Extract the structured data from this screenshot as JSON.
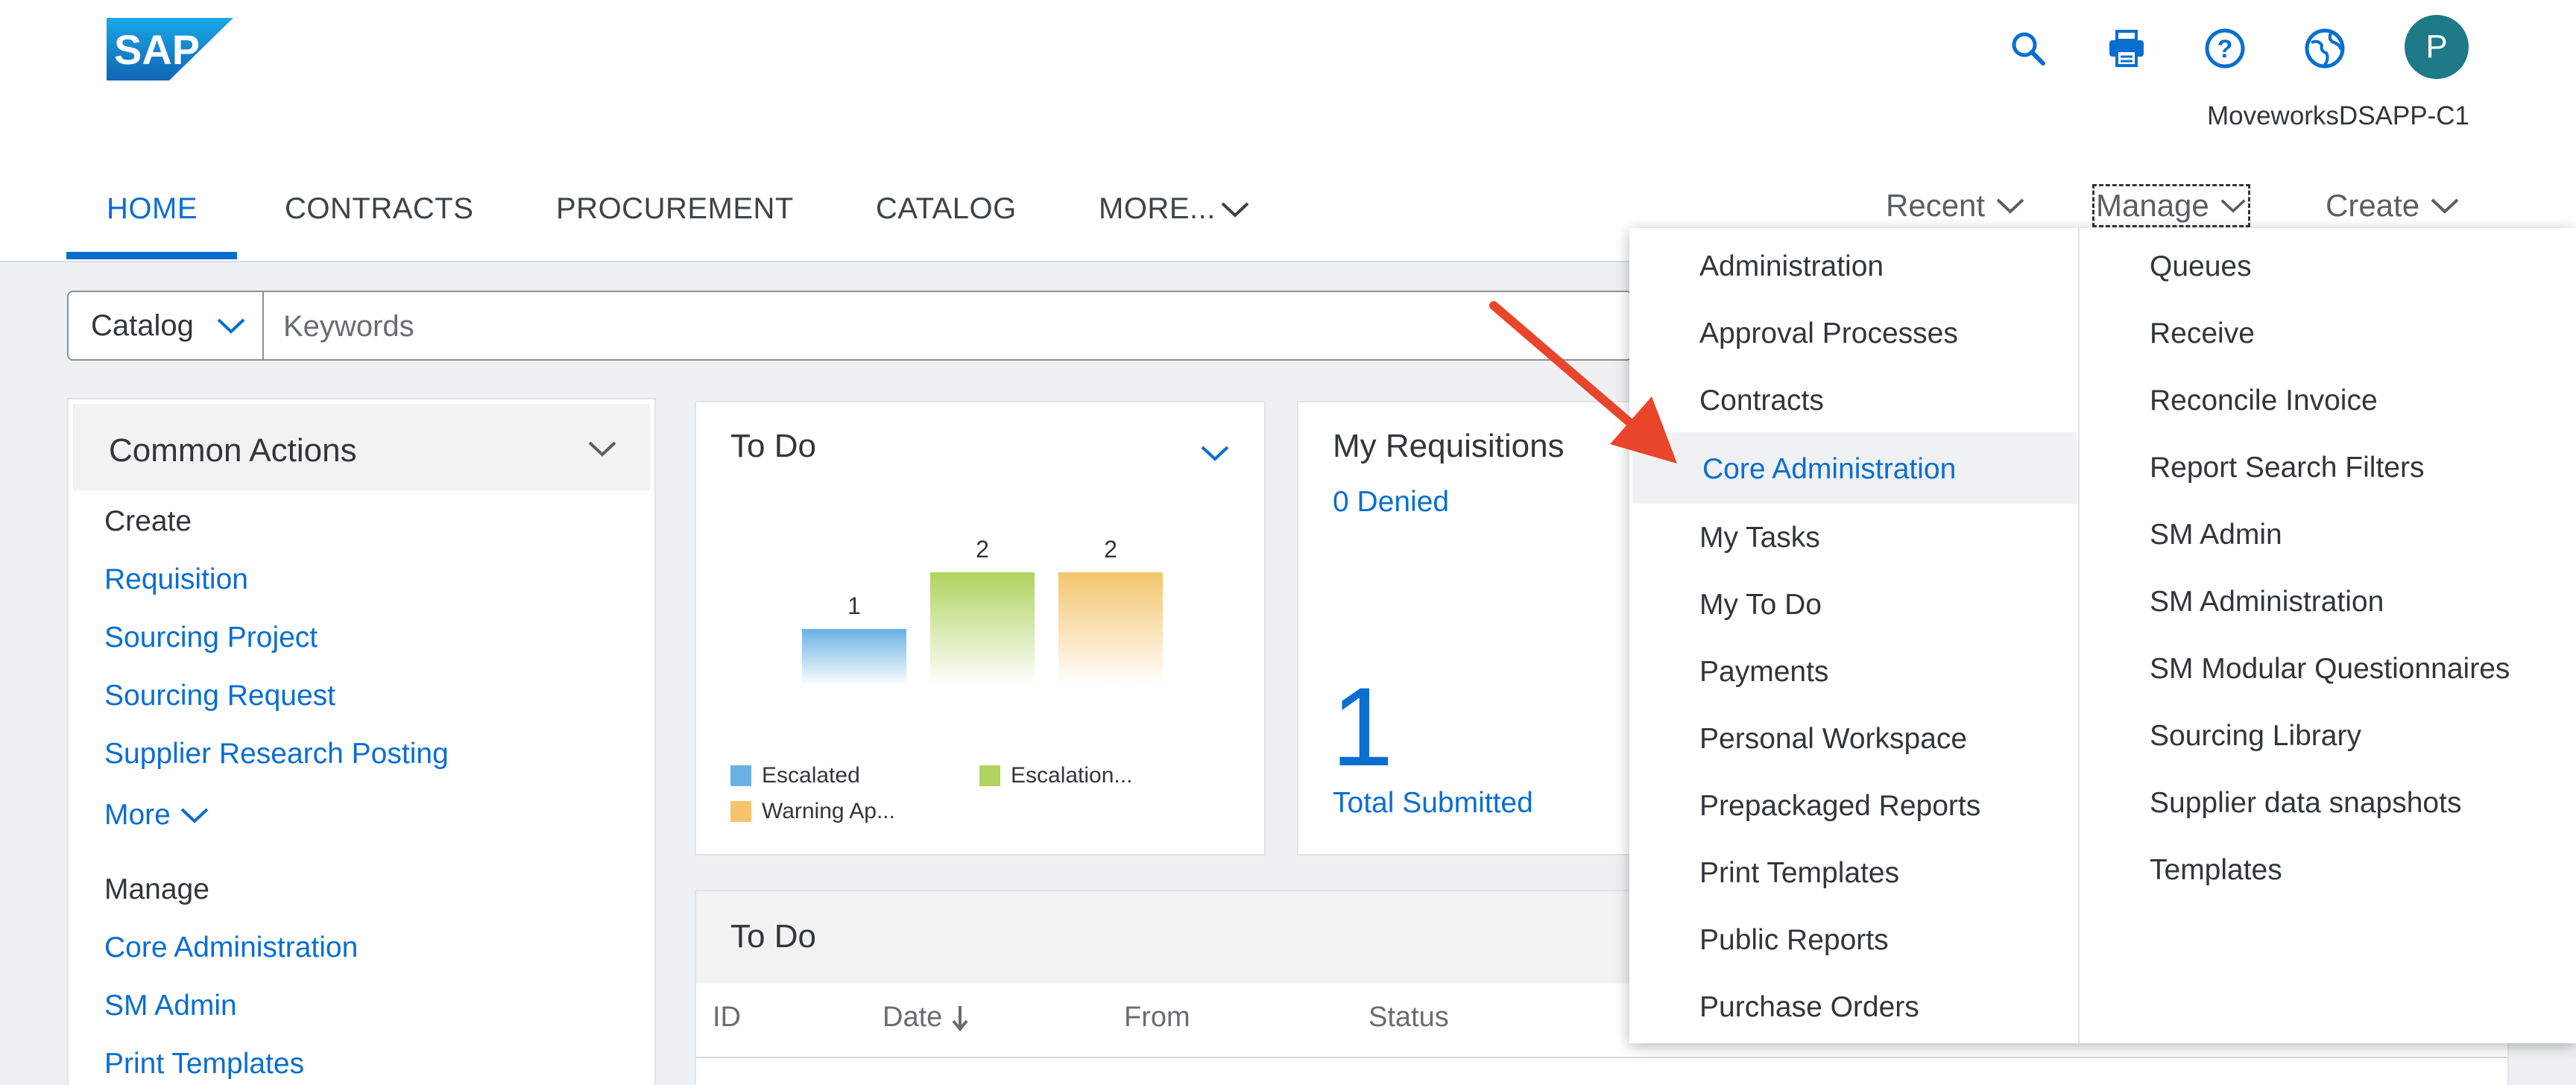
{
  "header": {
    "logo_text": "SAP",
    "tenant": "MoveworksDSAPP-C1",
    "avatar_initial": "P",
    "icons": [
      "search-icon",
      "printer-icon",
      "help-icon",
      "globe-icon"
    ]
  },
  "nav": {
    "tabs": [
      "HOME",
      "CONTRACTS",
      "PROCUREMENT",
      "CATALOG",
      "MORE..."
    ],
    "active_tab": "HOME",
    "menus": [
      "Recent",
      "Manage",
      "Create"
    ]
  },
  "search": {
    "scope": "Catalog",
    "placeholder": "Keywords"
  },
  "common_actions": {
    "title": "Common Actions",
    "create_label": "Create",
    "create_links": [
      "Requisition",
      "Sourcing Project",
      "Sourcing Request",
      "Supplier Research Posting"
    ],
    "more_label": "More",
    "manage_label": "Manage",
    "manage_links": [
      "Core Administration",
      "SM Admin",
      "Print Templates"
    ]
  },
  "todo_tile": {
    "title": "To Do",
    "chart_data": {
      "type": "bar",
      "categories": [
        "Escalated",
        "Escalation...",
        "Warning Ap..."
      ],
      "values": [
        1,
        2,
        2
      ],
      "colors": [
        "#69b1e3",
        "#b0d35f",
        "#f5c56e"
      ],
      "ylim": [
        0,
        2
      ]
    }
  },
  "requisitions_tile": {
    "title": "My Requisitions",
    "denied": "0 Denied",
    "total_value": "1",
    "total_label": "Total Submitted"
  },
  "todo_table": {
    "title": "To Do",
    "columns": [
      "ID",
      "Date",
      "From",
      "Status"
    ]
  },
  "manage_menu": {
    "left": [
      "Administration",
      "Approval Processes",
      "Contracts",
      "Core Administration",
      "My Tasks",
      "My To Do",
      "Payments",
      "Personal Workspace",
      "Prepackaged Reports",
      "Print Templates",
      "Public Reports",
      "Purchase Orders"
    ],
    "right": [
      "Queues",
      "Receive",
      "Reconcile Invoice",
      "Report Search Filters",
      "SM Admin",
      "SM Administration",
      "SM Modular Questionnaires",
      "Sourcing Library",
      "Supplier data snapshots",
      "Templates"
    ],
    "highlighted": "Core Administration"
  },
  "colors": {
    "accent": "#0a6ed1",
    "avatar": "#1d7a86",
    "arrow": "#e8452c"
  }
}
